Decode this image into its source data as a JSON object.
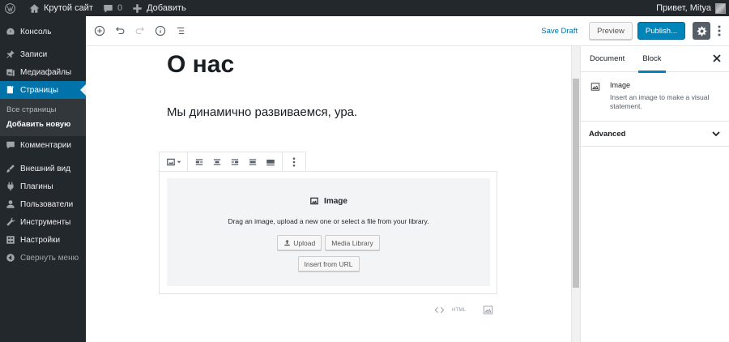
{
  "admin_bar": {
    "site_name": "Крутой сайт",
    "comments_count": "0",
    "add_new": "Добавить",
    "greeting": "Привет, Mitya"
  },
  "sidebar": {
    "items": [
      {
        "label": "Консоль",
        "icon": "dashboard-icon"
      },
      {
        "label": "Записи",
        "icon": "pin-icon"
      },
      {
        "label": "Медиафайлы",
        "icon": "media-icon"
      },
      {
        "label": "Страницы",
        "icon": "pages-icon"
      },
      {
        "label": "Комментарии",
        "icon": "comments-icon"
      },
      {
        "label": "Внешний вид",
        "icon": "appearance-icon"
      },
      {
        "label": "Плагины",
        "icon": "plugins-icon"
      },
      {
        "label": "Пользователи",
        "icon": "users-icon"
      },
      {
        "label": "Инструменты",
        "icon": "tools-icon"
      },
      {
        "label": "Настройки",
        "icon": "settings-icon"
      }
    ],
    "submenu": [
      "Все страницы",
      "Добавить новую"
    ],
    "collapse": "Свернуть меню"
  },
  "toolbar": {
    "save_draft": "Save Draft",
    "preview": "Preview",
    "publish": "Publish..."
  },
  "content": {
    "title": "О нас",
    "paragraph": "Мы динамично развиваемся, ура."
  },
  "image_block": {
    "label": "Image",
    "instructions": "Drag an image, upload a new one or select a file from your library.",
    "upload": "Upload",
    "media_library": "Media Library",
    "insert_url": "Insert from URL"
  },
  "inserter": {
    "html_label": "HTML"
  },
  "settings_sidebar": {
    "tabs": [
      "Document",
      "Block"
    ],
    "active_tab": "Block",
    "block_name": "Image",
    "block_description": "Insert an image to make a visual statement.",
    "panel_advanced": "Advanced"
  },
  "colors": {
    "admin_dark": "#23282d",
    "accent_blue": "#0073aa",
    "publish_blue": "#0085ba"
  }
}
